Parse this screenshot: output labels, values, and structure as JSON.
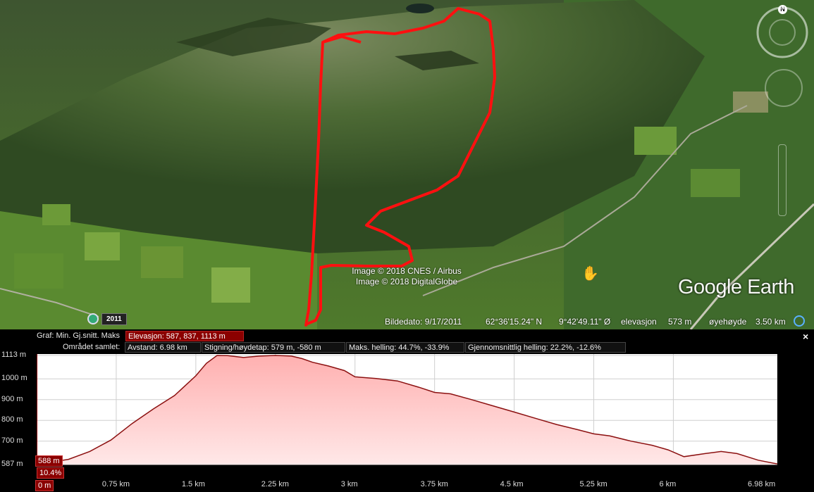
{
  "map": {
    "attribution": [
      "Image © 2018 CNES / Airbus",
      "Image © 2018 DigitalGlobe"
    ],
    "brand": "Google Earth",
    "compass_north": "N",
    "history_year": "2011",
    "status": {
      "date": "Bildedato: 9/17/2011",
      "lat": "62°36'15.24\" N",
      "lon": "9°42'49.11\" Ø",
      "elev_label": "elevasjon",
      "elev_value": "573 m",
      "eye_label": "øyehøyde",
      "eye_value": "3.50 km"
    },
    "track_color": "#ff1010",
    "icons": [
      "compass-ring-icon",
      "hand-cursor-icon",
      "historical-imagery-clock-icon",
      "sun-icon"
    ]
  },
  "profile": {
    "row1_label": "Graf: Min. Gj.snitt. Maks",
    "row1_value": "Elevasjon: 587, 837, 1113 m",
    "row2_label": "Området samlet:",
    "stats": [
      "Avstand: 6.98 km",
      "Stigning/høydetap: 579 m, -580 m",
      "Maks. helling: 44.7%, -33.9%",
      "Gjennomsnittlig helling: 22.2%, -12.6%"
    ],
    "close": "×",
    "cursor_elev": "588 m",
    "cursor_slope": "10.4%",
    "cursor_dist": "0 m"
  },
  "chart_data": {
    "type": "area",
    "title": "",
    "xlabel": "",
    "ylabel": "",
    "xlim": [
      0,
      6.98
    ],
    "ylim": [
      587,
      1113
    ],
    "y_ticks": [
      {
        "value": 1113,
        "label": "1113 m"
      },
      {
        "value": 1000,
        "label": "1000 m"
      },
      {
        "value": 900,
        "label": "900 m"
      },
      {
        "value": 800,
        "label": "800 m"
      },
      {
        "value": 700,
        "label": "700 m"
      },
      {
        "value": 587,
        "label": "587 m"
      }
    ],
    "x_ticks": [
      {
        "value": 0.75,
        "label": "0.75 km"
      },
      {
        "value": 1.5,
        "label": "1.5 km"
      },
      {
        "value": 2.25,
        "label": "2.25 km"
      },
      {
        "value": 3,
        "label": "3 km"
      },
      {
        "value": 3.75,
        "label": "3.75 km"
      },
      {
        "value": 4.5,
        "label": "4.5 km"
      },
      {
        "value": 5.25,
        "label": "5.25 km"
      },
      {
        "value": 6,
        "label": "6 km"
      },
      {
        "value": 6.98,
        "label": "6.98 km"
      }
    ],
    "series": [
      {
        "x": [
          0,
          0.3,
          0.5,
          0.7,
          0.9,
          1.1,
          1.3,
          1.5,
          1.6,
          1.7,
          1.8,
          1.95,
          2.1,
          2.25,
          2.4,
          2.5,
          2.6,
          2.75,
          2.9,
          3.0,
          3.2,
          3.4,
          3.6,
          3.75,
          3.9,
          4.1,
          4.3,
          4.5,
          4.7,
          4.9,
          5.1,
          5.25,
          5.4,
          5.6,
          5.8,
          5.95,
          6.1,
          6.3,
          6.45,
          6.6,
          6.8,
          6.98
        ],
        "y": [
          588,
          612,
          650,
          705,
          785,
          855,
          920,
          1015,
          1075,
          1113,
          1112,
          1103,
          1110,
          1113,
          1110,
          1098,
          1080,
          1062,
          1040,
          1010,
          1002,
          990,
          960,
          935,
          928,
          900,
          870,
          840,
          810,
          780,
          755,
          735,
          725,
          700,
          680,
          658,
          625,
          640,
          650,
          640,
          608,
          590
        ]
      }
    ],
    "grid": true,
    "fill_color": "#ffd5d5",
    "line_color": "#8b1010"
  }
}
